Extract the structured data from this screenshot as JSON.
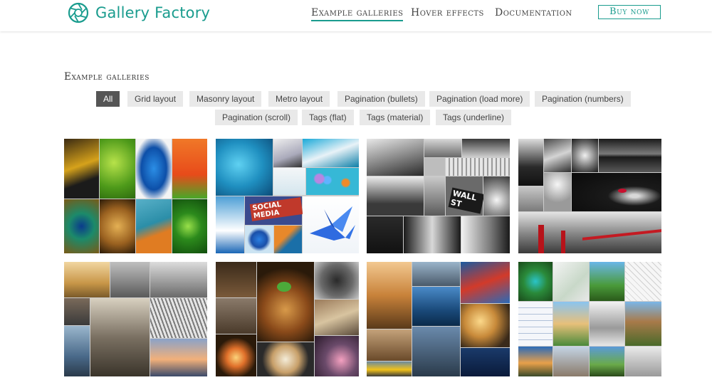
{
  "header": {
    "brand": "Gallery Factory",
    "nav": [
      {
        "label": "Example galleries",
        "active": true
      },
      {
        "label": "Hover effects",
        "active": false
      },
      {
        "label": "Documentation",
        "active": false
      }
    ],
    "buy_label": "Buy now",
    "accent_color": "#1a9c8e"
  },
  "section": {
    "title": "Example galleries"
  },
  "filters": [
    {
      "label": "All",
      "active": true
    },
    {
      "label": "Grid layout"
    },
    {
      "label": "Masonry layout"
    },
    {
      "label": "Metro layout"
    },
    {
      "label": "Pagination (bullets)"
    },
    {
      "label": "Pagination (load more)"
    },
    {
      "label": "Pagination (numbers)"
    },
    {
      "label": "Pagination (scroll)"
    },
    {
      "label": "Tags (flat)"
    },
    {
      "label": "Tags (material)"
    },
    {
      "label": "Tags (underline)"
    }
  ],
  "galleries": [
    {
      "theme": "nature-color"
    },
    {
      "theme": "blue-objects"
    },
    {
      "theme": "business-bw"
    },
    {
      "theme": "bw-art"
    },
    {
      "theme": "city-sepia"
    },
    {
      "theme": "food-drinks"
    },
    {
      "theme": "urban-color"
    },
    {
      "theme": "architecture"
    }
  ],
  "icons": {
    "logo": "aperture-icon",
    "wall_st_sign_text": "WALL ST",
    "social_media_text": "SOCIAL MEDIA"
  }
}
